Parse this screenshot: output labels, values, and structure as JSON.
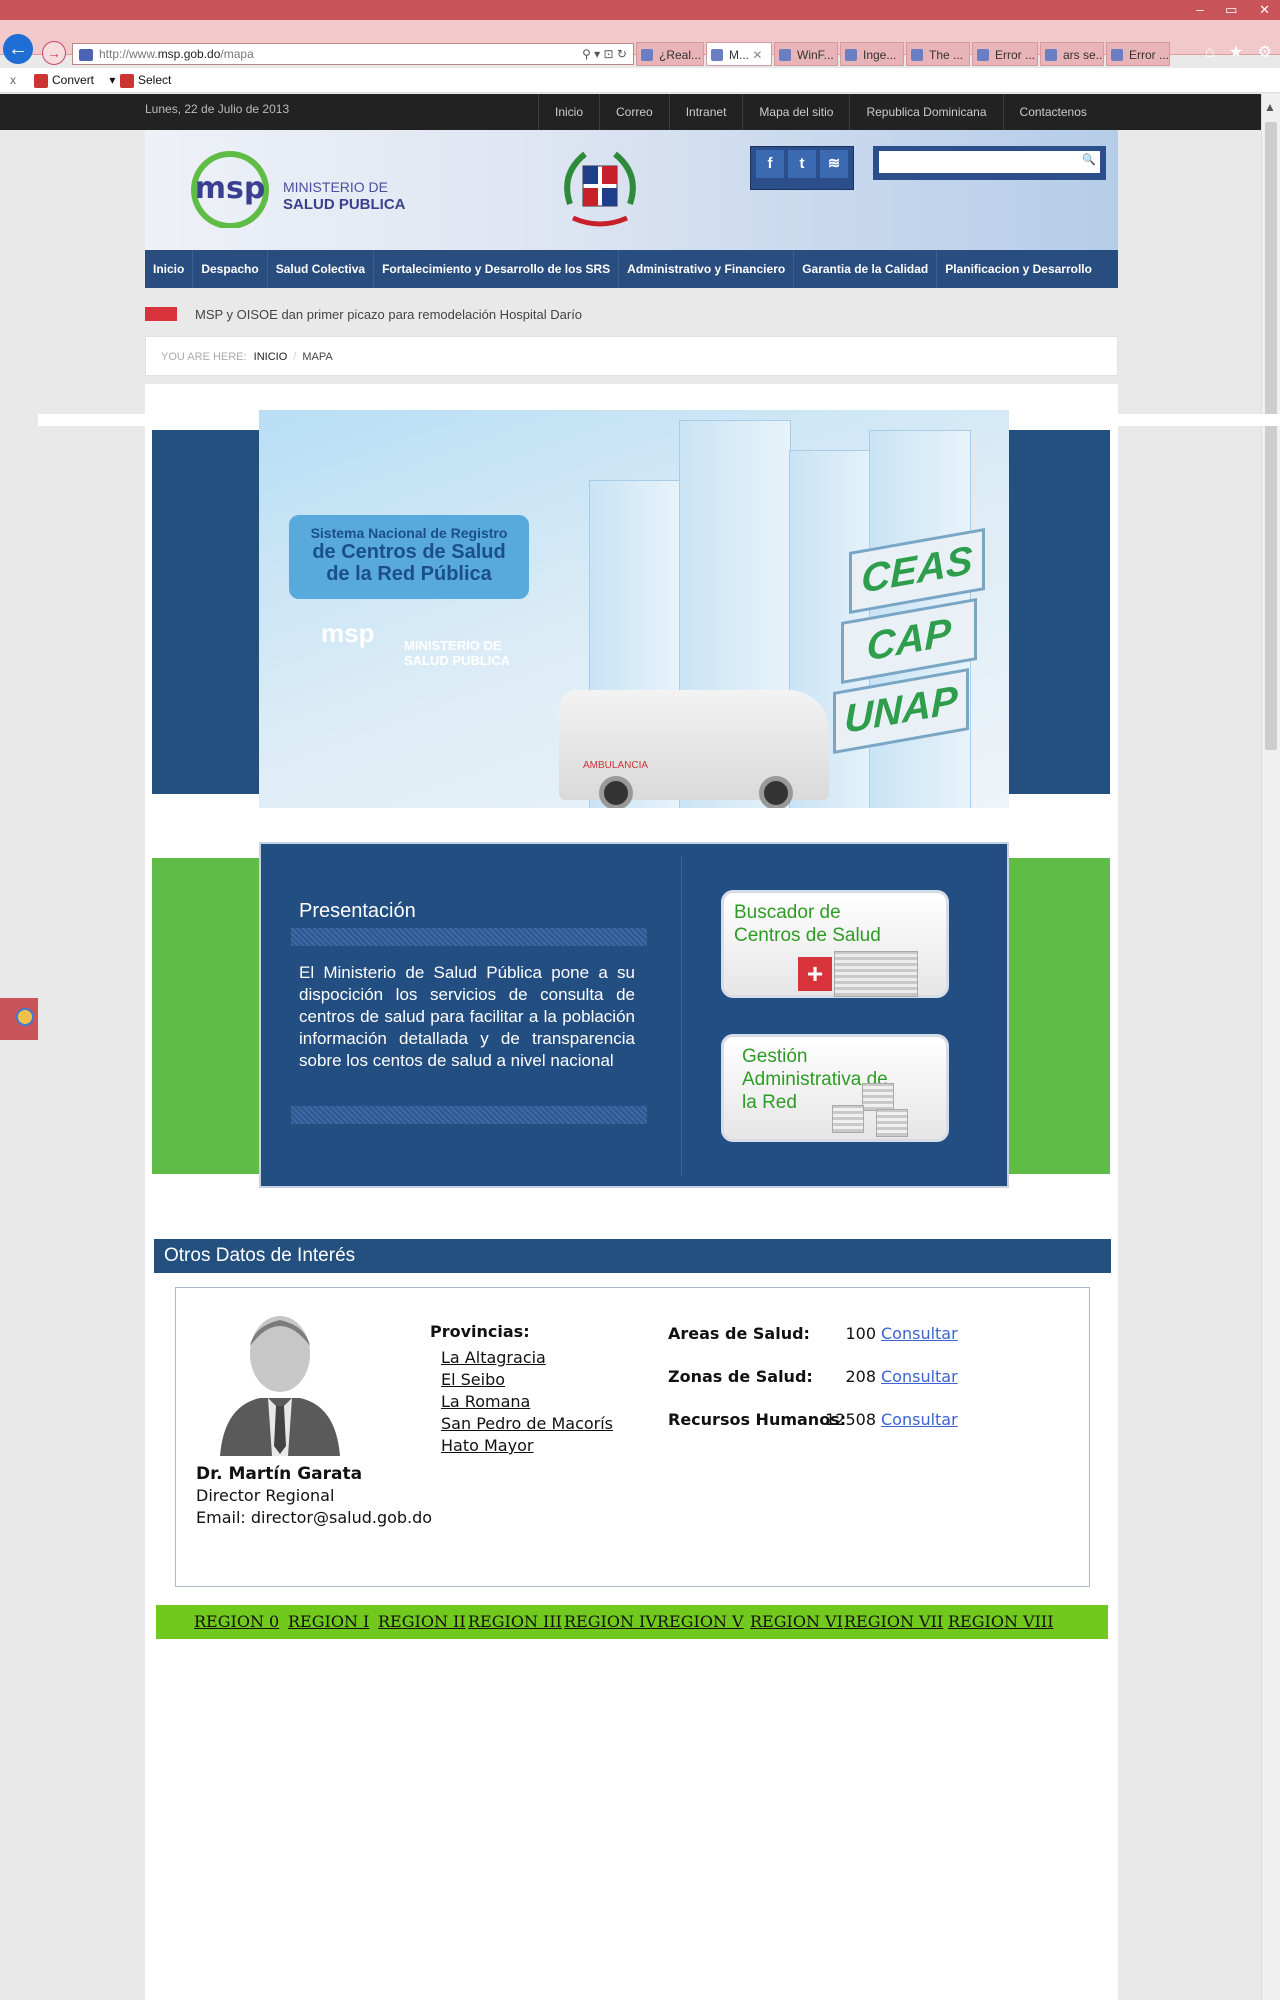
{
  "browser": {
    "window_controls": [
      "–",
      "▭",
      "✕"
    ],
    "url_prefix": "http://www.",
    "url_domain": "msp.gob.do",
    "url_path": "/mapa",
    "address_tools": "⚲ ▾ ⊡ ↻",
    "tabs": [
      {
        "label": "¿Real...",
        "active": false
      },
      {
        "label": "M...",
        "active": true,
        "close": "✕"
      },
      {
        "label": "WinF...",
        "active": false
      },
      {
        "label": "Inge...",
        "active": false
      },
      {
        "label": "The ...",
        "active": false
      },
      {
        "label": "Error ...",
        "active": false
      },
      {
        "label": "ars se...",
        "active": false
      },
      {
        "label": "Error ...",
        "active": false
      }
    ],
    "right_icons": [
      "⌂",
      "★",
      "⚙"
    ],
    "command_bar": {
      "close": "x",
      "convert": "Convert",
      "convert_caret": "▾",
      "select": "Select"
    }
  },
  "site": {
    "date": "Lunes, 22 de Julio de 2013",
    "top_links": [
      "Inicio",
      "Correo",
      "Intranet",
      "Mapa del sitio",
      "Republica Dominicana",
      "Contactenos"
    ],
    "logo_line1": "MINISTERIO DE",
    "logo_line2": "SALUD PUBLICA",
    "social": [
      "f",
      "t",
      "≋"
    ],
    "search_icon": "🔍",
    "main_nav": [
      "Inicio",
      "Despacho",
      "Salud Colectiva",
      "Fortalecimiento y Desarrollo de los SRS",
      "Administrativo y Financiero",
      "Garantia de la Calidad",
      "Planificacion y Desarrollo"
    ],
    "ticker": "MSP y OISOE dan primer picazo para remodelación Hospital Darío",
    "breadcrumb": {
      "label": "YOU ARE HERE:",
      "items": [
        "INICIO",
        "MAPA"
      ],
      "sep": "/"
    }
  },
  "banner": {
    "line1": "Sistema Nacional de Registro",
    "line2": "de Centros de Salud",
    "line3": "de la Red Pública",
    "logo_mark": "msp",
    "logo_line1": "MINISTERIO DE",
    "logo_line2": "SALUD PUBLICA",
    "signs": [
      "CEAS",
      "CAP",
      "UNAP"
    ],
    "van_text": "AMBULANCIA"
  },
  "presentation": {
    "title": "Presentación",
    "body": "El Ministerio de Salud Pública pone a su dispocición los servicios de consulta de centros de salud para facilitar a la población información detallada y de transparencia sobre los centos de salud a nivel nacional",
    "card1_line1": "Buscador de",
    "card1_line2": "Centros de Salud",
    "card1_cross": "+",
    "card2_line1": "Gestión",
    "card2_line2": "Administrativa de",
    "card2_line3": "la Red"
  },
  "otros": {
    "title": "Otros Datos de Interés",
    "director_name": "Dr. Martín Garata",
    "director_role": "Director Regional",
    "director_email": "Email: director@salud.gob.do",
    "provinces_title": "Provincias:",
    "provinces": [
      "La Altagracia",
      "El Seibo",
      "La Romana",
      "San Pedro de Macorís",
      "Hato Mayor"
    ],
    "stats": [
      {
        "label": "Areas de Salud:",
        "value": "100",
        "link": "Consultar"
      },
      {
        "label": "Zonas de Salud:",
        "value": "208",
        "link": "Consultar"
      },
      {
        "label": "Recursos Humanos:",
        "value": "12508",
        "link": "Consultar"
      }
    ]
  },
  "regions": [
    "REGION 0",
    "REGION I",
    "REGION II",
    "REGION III",
    "REGION IV",
    "REGION V",
    "REGION VI",
    "REGION VII",
    "REGION VIII"
  ],
  "colors": {
    "header_blue": "#23507f",
    "accent_green": "#5fbd47",
    "region_green": "#70c91c",
    "link_blue": "#3b63d1"
  }
}
